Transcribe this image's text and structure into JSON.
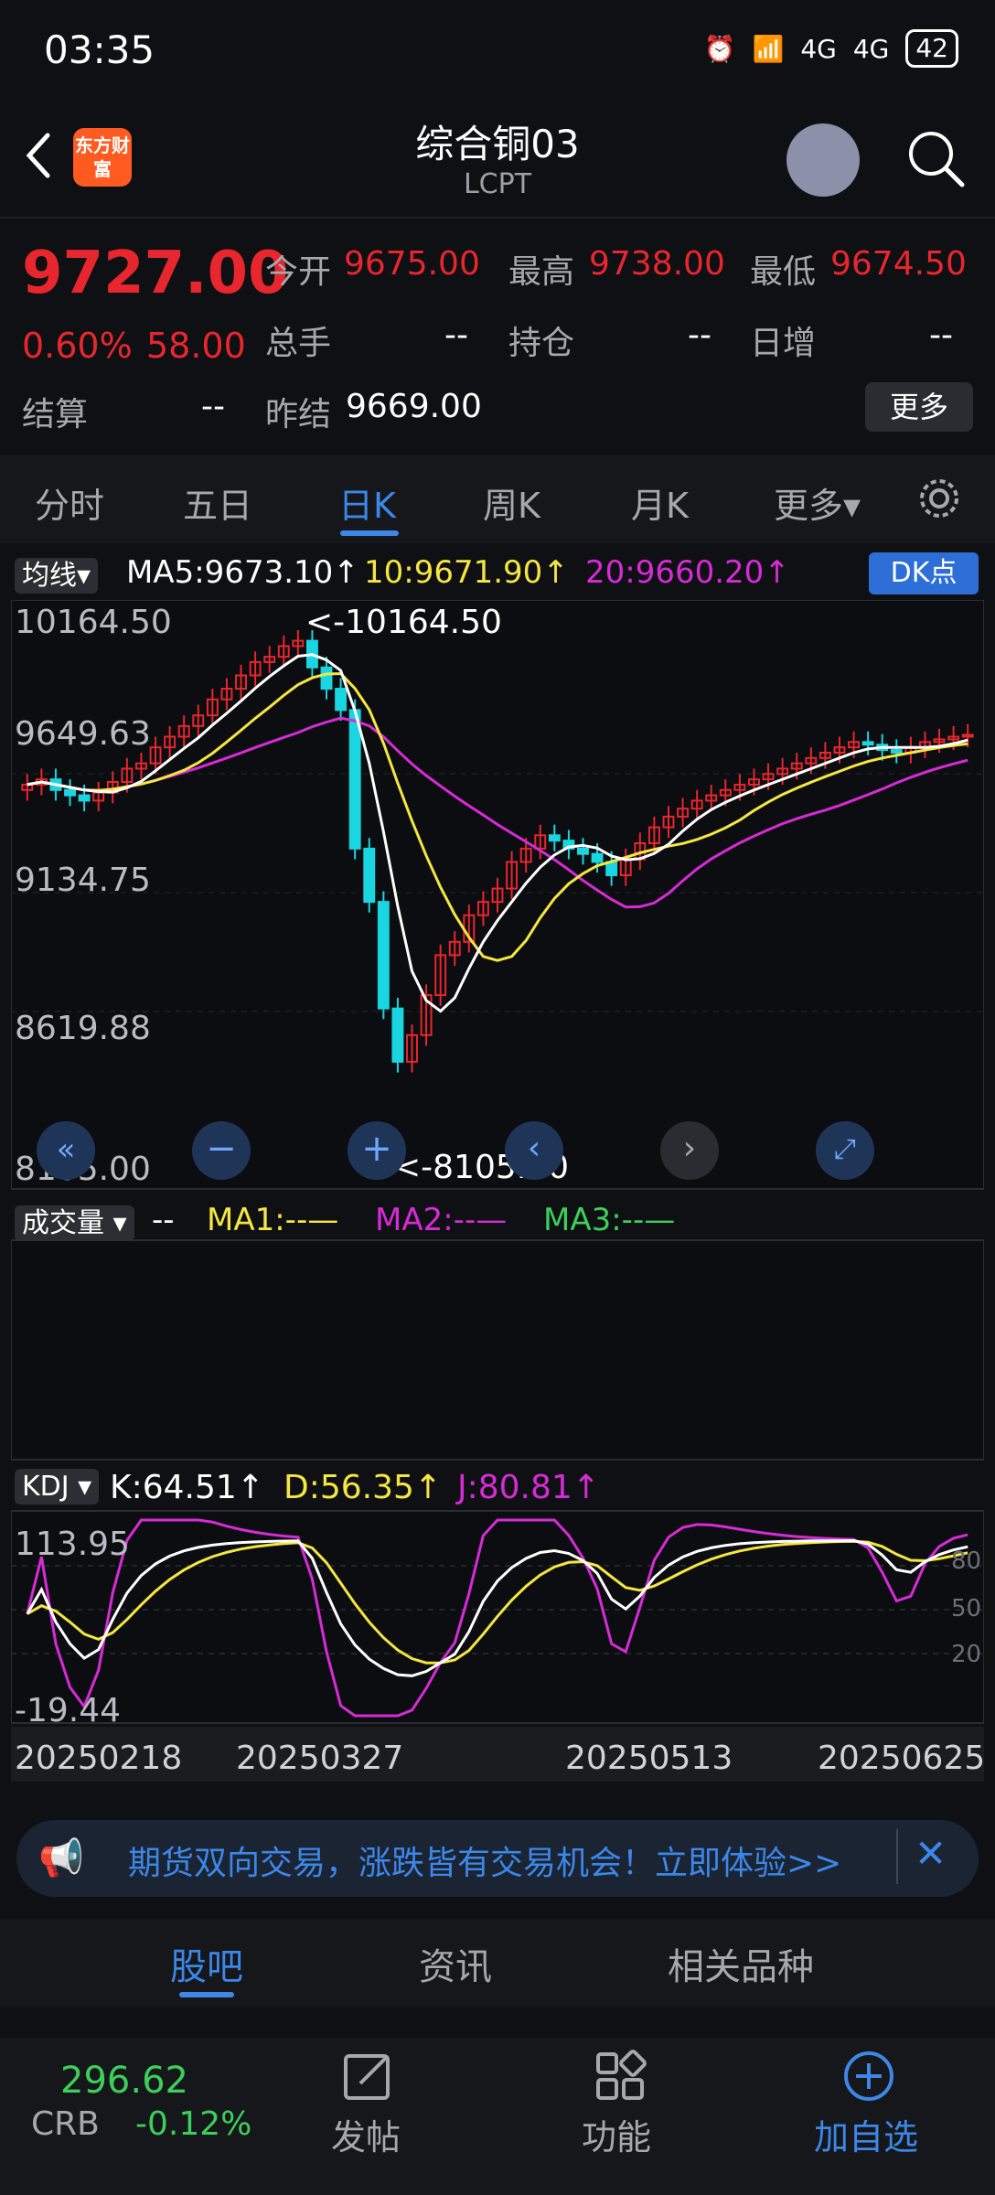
{
  "status": {
    "time": "03:35",
    "battery": "42",
    "net1": "4G",
    "net2": "4G"
  },
  "header": {
    "title": "综合铜03",
    "subtitle": "LCPT",
    "logo": "东方财富"
  },
  "quote": {
    "price": "9727.00",
    "change_pct": "0.60%",
    "change": "58.00",
    "open_label": "今开",
    "open": "9675.00",
    "high_label": "最高",
    "high": "9738.00",
    "low_label": "最低",
    "low": "9674.50",
    "volume_label": "总手",
    "volume": "--",
    "oi_label": "持仓",
    "oi": "--",
    "inc_label": "日增",
    "inc": "--",
    "settle_label": "结算",
    "settle": "--",
    "prev_settle_label": "昨结",
    "prev_settle": "9669.00",
    "more": "更多"
  },
  "tabs": [
    "分时",
    "五日",
    "日K",
    "周K",
    "月K",
    "更多▾"
  ],
  "active_tab": "日K",
  "ma_line": {
    "label": "均线▾",
    "ma5": "MA5:9673.10↑",
    "ma10": "10:9671.90↑",
    "ma20": "20:9660.20↑",
    "dk": "DK点"
  },
  "price_axis": [
    "10164.50",
    "9649.63",
    "9134.75",
    "8619.88",
    "8105.00"
  ],
  "high_marker": "<-10164.50",
  "low_marker": "<-8105.00",
  "volume_bar": {
    "label": "成交量 ▾",
    "dash": "--",
    "ma1": "MA1:--—",
    "ma2": "MA2:--—",
    "ma3": "MA3:--—"
  },
  "kdj": {
    "label": "KDJ ▾",
    "k": "K:64.51↑",
    "d": "D:56.35↑",
    "j": "J:80.81↑",
    "axis_top": "113.95",
    "axis_bottom": "-19.44",
    "lvl80": "80",
    "lvl50": "50",
    "lvl20": "20"
  },
  "dates": [
    "20250218",
    "20250327",
    "20250513",
    "20250625"
  ],
  "banner": "期货双向交易，涨跌皆有交易机会！立即体验>>",
  "subtabs": [
    "股吧",
    "资讯",
    "相关品种"
  ],
  "nav": {
    "crb_value": "296.62",
    "crb_label": "CRB",
    "crb_change": "-0.12%",
    "post": "发帖",
    "func": "功能",
    "add": "加自选"
  },
  "colors": {
    "up": "#e8262e",
    "down": "#19d6e0",
    "accent": "#3c87e8",
    "ma5": "#ffffff",
    "ma10": "#f5e642",
    "ma20": "#d62bd6"
  },
  "chart_data": {
    "type": "line",
    "title": "",
    "candles_close": [
      9540,
      9560,
      9520,
      9500,
      9480,
      9510,
      9550,
      9600,
      9620,
      9680,
      9720,
      9760,
      9800,
      9860,
      9900,
      9950,
      10000,
      10020,
      10060,
      10080,
      9980,
      9900,
      9820,
      9300,
      9100,
      8700,
      8500,
      8600,
      8750,
      8900,
      8950,
      9050,
      9100,
      9150,
      9250,
      9300,
      9350,
      9330,
      9300,
      9280,
      9250,
      9200,
      9260,
      9320,
      9380,
      9420,
      9450,
      9480,
      9500,
      9520,
      9540,
      9560,
      9580,
      9600,
      9620,
      9640,
      9660,
      9680,
      9700,
      9690,
      9670,
      9660,
      9680,
      9700,
      9710,
      9720,
      9727
    ],
    "ylim": [
      8105,
      10164.5
    ]
  }
}
